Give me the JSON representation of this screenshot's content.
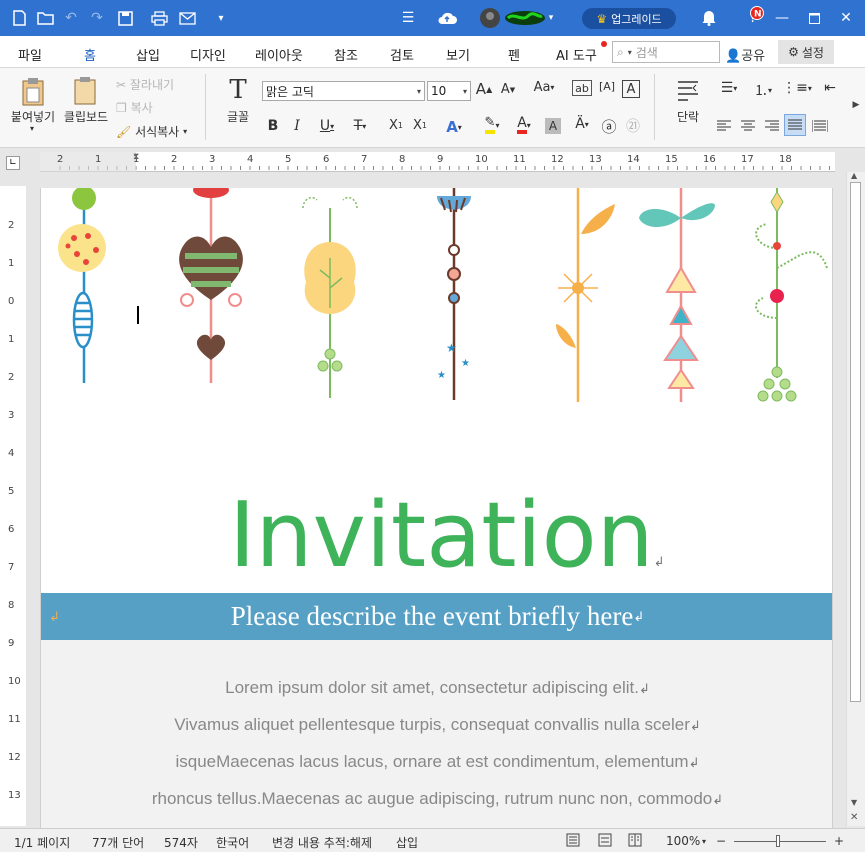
{
  "titlebar": {
    "upgrade_label": "업그레이드",
    "accent": "#2f72d0"
  },
  "menu": {
    "items": [
      "파일",
      "홈",
      "삽입",
      "디자인",
      "레이아웃",
      "참조",
      "검토",
      "보기",
      "펜",
      "AI 도구"
    ],
    "active": "홈",
    "search_placeholder": "검색",
    "share_label": "공유",
    "settings_label": "설정"
  },
  "ribbon": {
    "paste_label": "붙여넣기",
    "clipboard_label": "클립보드",
    "cut_label": "잘라내기",
    "copy_label": "복사",
    "format_painter_label": "서식복사",
    "font_group_label": "글꼴",
    "font_name": "맑은 고딕",
    "font_size": "10",
    "paragraph_label": "단락"
  },
  "ruler": {
    "h_numbers": [
      "2",
      "1",
      "1",
      "2",
      "3",
      "4",
      "5",
      "6",
      "7",
      "8",
      "9",
      "10",
      "11",
      "12",
      "13",
      "14",
      "15",
      "16",
      "17",
      "18"
    ],
    "v_numbers": [
      "2",
      "1",
      "0",
      "1",
      "2",
      "3",
      "4",
      "5",
      "6",
      "7",
      "8",
      "9",
      "10",
      "11",
      "12",
      "13"
    ]
  },
  "document": {
    "title": "Invitation",
    "subtitle": "Please describe the event briefly here",
    "body_lines": [
      "Lorem ipsum dolor sit amet, consectetur adipiscing elit.",
      "Vivamus aliquet pellentesque turpis, consequat convallis nulla sceler",
      "isqueMaecenas lacus lacus, ornare at est condimentum, elementum",
      "rhoncus tellus.Maecenas ac augue adipiscing, rutrum nunc non, commodo"
    ],
    "title_color": "#3fb35a",
    "band_color": "#56a0c6"
  },
  "status": {
    "page": "1/1 페이지",
    "words": "77개 단어",
    "chars": "574자",
    "language": "한국어",
    "track_changes": "변경 내용 추적:해제",
    "mode": "삽입",
    "zoom": "100%"
  }
}
